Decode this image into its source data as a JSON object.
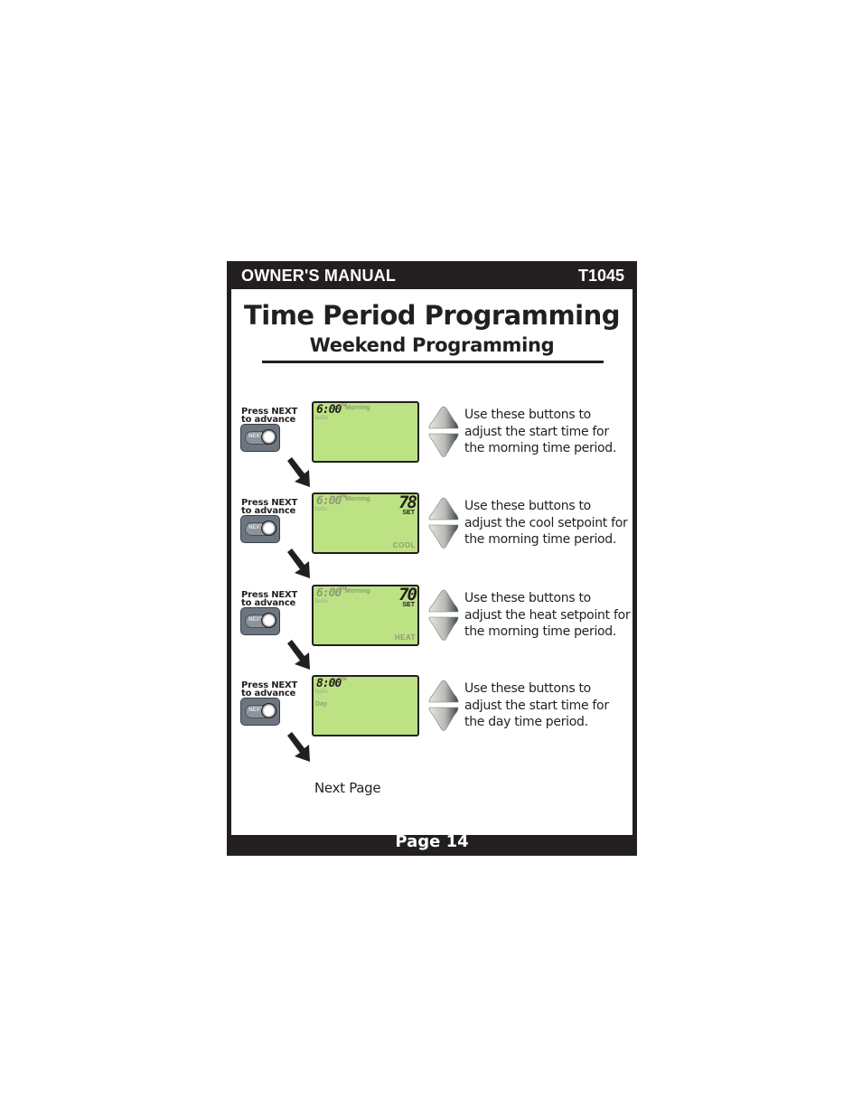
{
  "header": {
    "left": "OWNER'S MANUAL",
    "right": "T1045"
  },
  "title": "Time Period Programming",
  "subtitle": "Weekend Programming",
  "press_next": {
    "line1": "Press NEXT",
    "line2": "to advance",
    "button_label": "NEXT"
  },
  "steps": [
    {
      "lcd": {
        "time": "6:00",
        "ampm": "AM",
        "period": "Morning",
        "days": "SaSu",
        "setpoint": "",
        "set_label": "",
        "mode": "",
        "day_label": ""
      },
      "description": [
        "Use these buttons to",
        "adjust the start time for",
        "the morning time period."
      ]
    },
    {
      "lcd": {
        "time": "6:00",
        "ampm": "AM",
        "period": "Morning",
        "days": "SaSu",
        "setpoint": "78",
        "set_label": "SET",
        "mode": "COOL",
        "day_label": ""
      },
      "description": [
        "Use these buttons to",
        "adjust the cool setpoint for",
        "the morning time period."
      ]
    },
    {
      "lcd": {
        "time": "6:00",
        "ampm": "AM",
        "period": "Morning",
        "days": "SaSu",
        "setpoint": "70",
        "set_label": "SET",
        "mode": "HEAT",
        "day_label": ""
      },
      "description": [
        "Use these buttons to",
        "adjust the heat setpoint for",
        "the morning time period."
      ]
    },
    {
      "lcd": {
        "time": "8:00",
        "ampm": "AM",
        "period": "",
        "days": "SaSu",
        "setpoint": "",
        "set_label": "",
        "mode": "",
        "day_label": "Day"
      },
      "description": [
        "Use these buttons to",
        "adjust the start time for",
        "the day time period."
      ]
    }
  ],
  "next_page": "Next Page",
  "footer": "Page 14",
  "icons": {
    "up": "up-arrow-button-icon",
    "down": "down-arrow-button-icon",
    "flow": "diagonal-arrow-icon"
  }
}
